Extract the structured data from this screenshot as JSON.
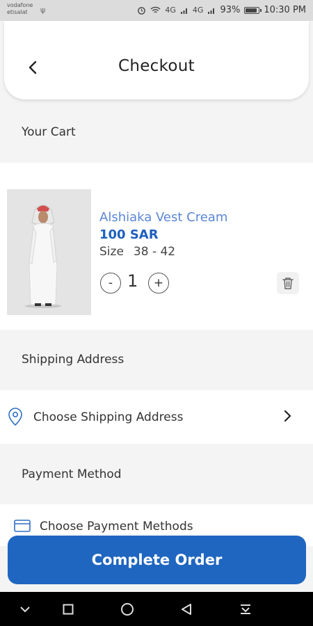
{
  "status_bar": {
    "carrier_1": "vodafone",
    "carrier_2": "etisalat",
    "network_1": "4G",
    "network_2": "4G",
    "battery": "93%",
    "time": "10:30 PM"
  },
  "header": {
    "title": "Checkout"
  },
  "cart": {
    "section_title": "Your Cart",
    "item": {
      "name": "Alshiaka Vest Cream",
      "price": "100 SAR",
      "size_label": "Size",
      "size_value": "38 - 42",
      "quantity": "1",
      "minus_label": "-",
      "plus_label": "+"
    }
  },
  "shipping": {
    "section_title": "Shipping Address",
    "choose_label": "Choose Shipping Address"
  },
  "payment": {
    "section_title": "Payment Method",
    "choose_label": "Choose Payment Methods"
  },
  "actions": {
    "complete_order_label": "Complete Order"
  },
  "colors": {
    "accent": "#1f66c1",
    "price": "#1f5fbf",
    "product_name": "#5b86d6"
  }
}
